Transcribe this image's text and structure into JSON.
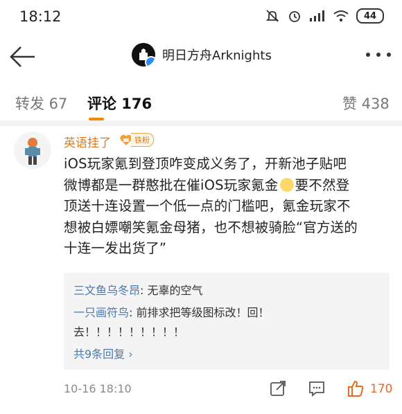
{
  "status_bar": {
    "time": "18:12",
    "battery": "44",
    "icons": [
      "mute-icon",
      "alarm-icon",
      "signal-icon",
      "wifi-icon",
      "battery-icon"
    ]
  },
  "header": {
    "title": "明日方舟Arknights",
    "icons": [
      "back-arrow-icon",
      "verified-icon",
      "more-icon"
    ]
  },
  "tabs": [
    {
      "label": "转发 67"
    },
    {
      "label": "评论 176",
      "active": true
    },
    {
      "label": "赞 438"
    }
  ],
  "comment": {
    "username": "英语挂了",
    "badge": "铁粉",
    "text_lines": [
      "iOS玩家氪到登顶咋变成义务了，开新池子贴吧",
      "微博都是一群憨批在催iOS玩家氪金",
      "要不然登",
      "顶送十连设置一个低一点的门槛吧，氪金玩家不",
      "想被白嫖嘲笑氪金母猪，也不想被骑脸“官方送的",
      "十连一发出货了”"
    ],
    "replies": [
      {
        "name": "三文鱼乌冬昂",
        "text": ": 无辜的空气"
      },
      {
        "name": "一只画符鸟",
        "text": ": 前排求把等级图标改！回！"
      },
      {
        "name": "",
        "text": "去！！！！！！！！！"
      }
    ],
    "reply_more": "共9条回复 ›",
    "time": "10-16 18:10",
    "likes": "170",
    "accent_color": "#e07b1a",
    "link_color": "#4a78b3"
  }
}
